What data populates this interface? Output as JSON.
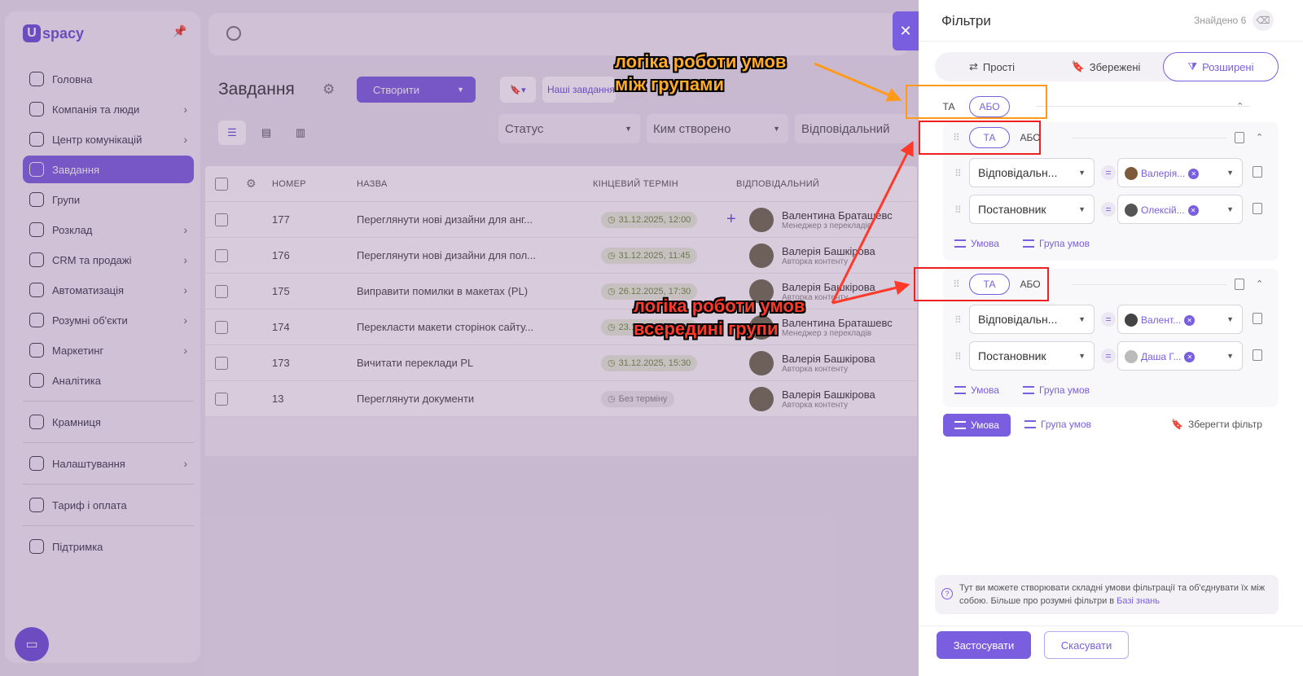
{
  "app": {
    "logo": "spacy",
    "logo_mark": "U"
  },
  "sidebar": {
    "items": [
      {
        "label": "Головна",
        "icon": "home-icon",
        "chev": false
      },
      {
        "label": "Компанія та люди",
        "icon": "company-icon",
        "chev": true
      },
      {
        "label": "Центр комунікацій",
        "icon": "chat-icon",
        "chev": true
      },
      {
        "label": "Завдання",
        "icon": "check-circle-icon",
        "chev": false,
        "active": true
      },
      {
        "label": "Групи",
        "icon": "users-icon",
        "chev": false
      },
      {
        "label": "Розклад",
        "icon": "calendar-icon",
        "chev": true
      },
      {
        "label": "CRM та продажі",
        "icon": "database-icon",
        "chev": true
      },
      {
        "label": "Автоматизація",
        "icon": "bolt-icon",
        "chev": true
      },
      {
        "label": "Розумні об'єкти",
        "icon": "cube-icon",
        "chev": true
      },
      {
        "label": "Маркетинг",
        "icon": "megaphone-icon",
        "chev": true
      },
      {
        "label": "Аналітика",
        "icon": "chart-icon",
        "chev": false
      }
    ],
    "shop": "Крамниця",
    "settings": "Налаштування",
    "billing": "Тариф і оплата",
    "support": "Підтримка"
  },
  "main": {
    "title": "Завдання",
    "create": "Створити",
    "our_tasks": "Наші завдання",
    "filters": [
      "Статус",
      "Ким створено",
      "Відповідальний"
    ],
    "headers": {
      "number": "НОМЕР",
      "name": "НАЗВА",
      "deadline": "КІНЦЕВИЙ ТЕРМІН",
      "responsible": "ВІДПОВІДАЛЬНИЙ"
    },
    "rows": [
      {
        "num": "177",
        "name": "Переглянути нові дизайни для анг...",
        "deadline": "31.12.2025, 12:00",
        "person": "Валентина Браташевс",
        "role": "Менеджер з перекладів"
      },
      {
        "num": "176",
        "name": "Переглянути нові дизайни для пол...",
        "deadline": "31.12.2025, 11:45",
        "person": "Валерія Башкірова",
        "role": "Авторка контенту"
      },
      {
        "num": "175",
        "name": "Виправити помилки в макетах (PL)",
        "deadline": "26.12.2025, 17:30",
        "person": "Валерія Башкірова",
        "role": "Авторка контенту"
      },
      {
        "num": "174",
        "name": "Перекласти макети сторінок сайту...",
        "deadline": "23.12.2025, 10:00",
        "person": "Валентина Браташевс",
        "role": "Менеджер з перекладів"
      },
      {
        "num": "173",
        "name": "Вичитати переклади PL",
        "deadline": "31.12.2025, 15:30",
        "person": "Валерія Башкірова",
        "role": "Авторка контенту"
      },
      {
        "num": "13",
        "name": "Переглянути документи",
        "deadline": "Без терміну",
        "person": "Валерія Башкірова",
        "role": "Авторка контенту"
      }
    ]
  },
  "panel": {
    "title": "Фільтри",
    "found": "Знайдено 6",
    "tabs": [
      "Прості",
      "Збережені",
      "Розширені"
    ],
    "and": "ТА",
    "or": "АБО",
    "group1": [
      {
        "field": "Відповідальн...",
        "value": "Валерія..."
      },
      {
        "field": "Постановник",
        "value": "Олексій..."
      }
    ],
    "group2": [
      {
        "field": "Відповідальн...",
        "value": "Валент..."
      },
      {
        "field": "Постановник",
        "value": "Даша Г..."
      }
    ],
    "add_condition": "Умова",
    "add_group": "Група умов",
    "save_filter": "Зберегти фільтр",
    "help_text": "Тут ви можете створювати складні умови фільтрації та об'єднувати їх між собою. Більше про розумні фільтри в ",
    "help_link": "Базі знань",
    "apply": "Застосувати",
    "cancel": "Скасувати",
    "close": "✕"
  },
  "annotations": {
    "between_1": "логіка роботи умов",
    "between_2": "між групами",
    "inside_1": "логіка роботи умов",
    "inside_2": "всередині групи"
  },
  "colors": {
    "accent": "#7a5ee0",
    "annotation_orange": "#ffab28",
    "annotation_red": "#ff3a2a"
  }
}
